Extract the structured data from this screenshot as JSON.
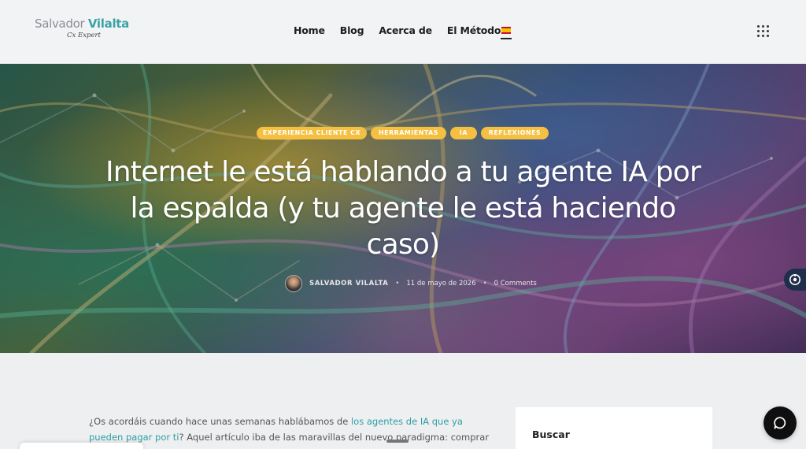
{
  "header": {
    "logo_first": "Salvador",
    "logo_last": "Vilalta",
    "logo_tagline": "Cx Expert",
    "nav": [
      "Home",
      "Blog",
      "Acerca de",
      "El Método 7"
    ],
    "language_icon": "spain-flag-icon",
    "menu_icon": "apps-grid-icon"
  },
  "hero": {
    "categories": [
      "EXPERIENCIA CLIENTE CX",
      "HERRAMIENTAS",
      "IA",
      "REFLEXIONES"
    ],
    "title": "Internet le está hablando a tu agente IA por la espalda (y tu agente le está haciendo caso)",
    "author": "SALVADOR VILALTA",
    "date": "11 de mayo de 2026",
    "comments": "0 Comments",
    "accent_color": "#f5c042"
  },
  "article": {
    "p1_before": "¿Os acordáis cuando hace unas semanas hablábamos de ",
    "p1_link": "los agentes de IA que ya pueden pagar por ti",
    "p1_after": "? Aquel artículo iba de las maravillas del nuevo paradigma: comprar zapatillas sin tocar el",
    "link_color": "#2d9fa6"
  },
  "sidebar": {
    "title": "Buscar"
  },
  "widgets": {
    "chat_icon": "chat-bubble-icon",
    "side_icon": "accessibility-icon"
  }
}
